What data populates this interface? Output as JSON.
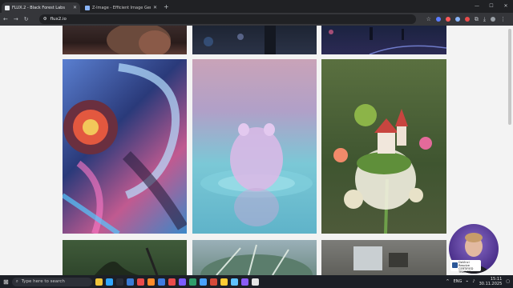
{
  "browser": {
    "tabs": [
      {
        "title": "FLUX.2 - Black Forest Labs",
        "active": true
      },
      {
        "title": "Z-Image - Efficient Image Gen...",
        "active": false
      }
    ],
    "url": "flux2.io"
  },
  "taskbar": {
    "search_placeholder": "Type here to search",
    "language": "ENG",
    "time": "15:11",
    "date": "30.11.2025"
  },
  "webcam_badge": {
    "line1": "DaVinci",
    "line2": "Resolve",
    "line3": "CERTIFIED",
    "line4": "TRAINER"
  },
  "colors": {
    "page_bg": "#f3f3f3",
    "tab_strip": "#202124",
    "toolbar": "#35363a",
    "taskbar": "#1c1f26"
  }
}
